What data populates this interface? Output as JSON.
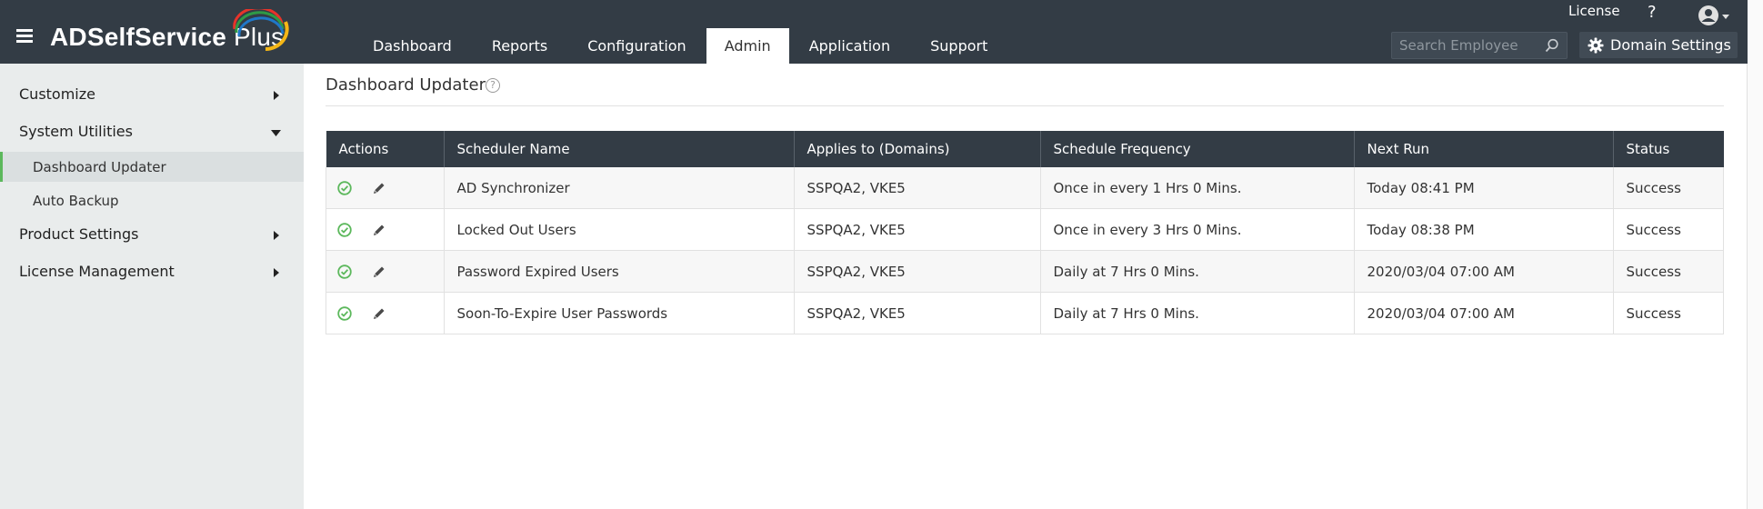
{
  "app": {
    "name_bold": "ADSelfService",
    "name_rest": " Plus"
  },
  "topbar": {
    "license": "License",
    "help": "?",
    "search_placeholder": "Search Employee",
    "domain_settings": "Domain Settings"
  },
  "nav": {
    "tabs": [
      "Dashboard",
      "Reports",
      "Configuration",
      "Admin",
      "Application",
      "Support"
    ],
    "active": "Admin"
  },
  "sidebar": {
    "customize": "Customize",
    "system_utilities": "System Utilities",
    "dashboard_updater": "Dashboard Updater",
    "auto_backup": "Auto Backup",
    "product_settings": "Product Settings",
    "license_management": "License Management"
  },
  "page": {
    "title": "Dashboard Updater",
    "help": "?"
  },
  "table": {
    "headers": [
      "Actions",
      "Scheduler Name",
      "Applies to (Domains)",
      "Schedule Frequency",
      "Next Run",
      "Status"
    ],
    "rows": [
      {
        "name": "AD Synchronizer",
        "domains": "SSPQA2, VKE5",
        "frequency": "Once in every 1 Hrs 0 Mins.",
        "next_run": "Today 08:41 PM",
        "status": "Success"
      },
      {
        "name": "Locked Out Users",
        "domains": "SSPQA2, VKE5",
        "frequency": "Once in every 3 Hrs 0 Mins.",
        "next_run": "Today 08:38 PM",
        "status": "Success"
      },
      {
        "name": "Password Expired Users",
        "domains": "SSPQA2, VKE5",
        "frequency": "Daily at 7 Hrs 0 Mins.",
        "next_run": "2020/03/04 07:00 AM",
        "status": "Success"
      },
      {
        "name": "Soon-To-Expire User Passwords",
        "domains": "SSPQA2, VKE5",
        "frequency": "Daily at 7 Hrs 0 Mins.",
        "next_run": "2020/03/04 07:00 AM",
        "status": "Success"
      }
    ]
  },
  "colors": {
    "header_bg": "#333c45",
    "sidebar_bg": "#e9ecec",
    "enabled_green": "#5cb85c"
  },
  "icons": [
    "hamburger-icon",
    "logo-arc-icon",
    "search-icon",
    "gear-icon",
    "user-avatar-icon",
    "chevron-down-icon",
    "caret-right-icon",
    "caret-down-icon",
    "check-circle-icon",
    "pencil-icon",
    "help-circle-icon"
  ]
}
